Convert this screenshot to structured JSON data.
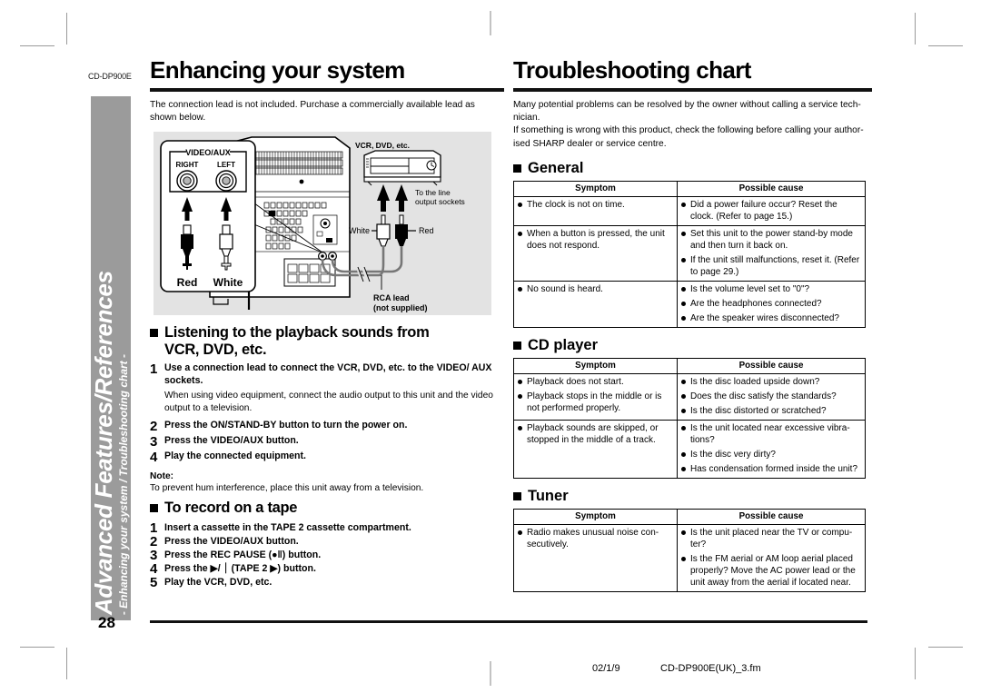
{
  "document": {
    "model_code": "CD-DP900E",
    "page_number": "28",
    "footer_date": "02/1/9",
    "footer_filename": "CD-DP900E(UK)_3.fm"
  },
  "side_tab": {
    "title": "Advanced Features/References",
    "subtitle": "- Enhancing your system / Troubleshooting chart -",
    "background_color": "#9b9b9b",
    "text_color": "#ffffff"
  },
  "left_column": {
    "heading": "Enhancing your system",
    "intro": "The connection lead is not included. Purchase a commercially available lead as shown below.",
    "diagram": {
      "labels": {
        "panel_title": "VIDEO/AUX",
        "right": "RIGHT",
        "left": "LEFT",
        "plug_red": "Red",
        "plug_white": "White",
        "device": "VCR, DVD, etc.",
        "to_line_output": "To the line\noutput sockets",
        "to_line_output_l1": "To the line",
        "to_line_output_l2": "output sockets",
        "cable_white": "White",
        "cable_red": "Red",
        "rca_lead_l1": "RCA lead",
        "rca_lead_l2": "(not supplied)"
      }
    },
    "section_listening": {
      "heading_line1": "Listening to the playback sounds from",
      "heading_line2": "VCR, DVD, etc.",
      "steps": [
        {
          "num": "1",
          "title": "Use a connection lead to connect the VCR, DVD, etc. to the VIDEO/ AUX sockets.",
          "note": "When using video equipment, connect the audio output to this unit and the video output to a television."
        },
        {
          "num": "2",
          "title": "Press the ON/STAND-BY button to turn the power on."
        },
        {
          "num": "3",
          "title": "Press the VIDEO/AUX button."
        },
        {
          "num": "4",
          "title": "Play the connected equipment."
        }
      ]
    },
    "note": {
      "label": "Note:",
      "text": "To prevent hum interference, place this unit away from a television."
    },
    "section_record": {
      "heading": "To record on a tape",
      "steps": [
        {
          "num": "1",
          "title": "Insert a cassette in the TAPE 2 cassette compartment."
        },
        {
          "num": "2",
          "title": "Press the VIDEO/AUX button."
        },
        {
          "num": "3",
          "title": "Press the REC PAUSE (●‖) button."
        },
        {
          "num": "4",
          "title": "Press the ▶/ ⏐ (TAPE 2 ▶) button."
        },
        {
          "num": "5",
          "title": "Play the VCR, DVD, etc."
        }
      ]
    }
  },
  "right_column": {
    "heading": "Troubleshooting chart",
    "intro_line1": "Many potential problems can be resolved by the owner without calling a service tech-",
    "intro_line2": "nician.",
    "intro_line3": "If something is wrong with this product, check the following before calling your author-",
    "intro_line4": "ised SHARP dealer or service centre.",
    "table_headers": {
      "symptom": "Symptom",
      "possible_cause": "Possible cause"
    },
    "sections": [
      {
        "heading": "General",
        "rows": [
          {
            "symptoms": [
              "The clock is not on time."
            ],
            "causes": [
              "Did a power failure occur? Reset the clock. (Refer to page 15.)"
            ]
          },
          {
            "symptoms": [
              "When a button is pressed, the unit does not respond."
            ],
            "causes": [
              "Set this unit to the power stand-by mode and then turn it back on.",
              "If the unit still malfunctions, reset it. (Refer to page 29.)"
            ]
          },
          {
            "symptoms": [
              "No sound is heard."
            ],
            "causes": [
              "Is the volume level set to \"0\"?",
              "Are the headphones connected?",
              "Are the speaker wires disconnected?"
            ]
          }
        ]
      },
      {
        "heading": "CD player",
        "rows": [
          {
            "symptoms": [
              "Playback does not start.",
              "Playback stops in the middle or is not performed properly."
            ],
            "causes": [
              "Is the disc loaded upside down?",
              "Does the disc satisfy the standards?",
              "Is the disc distorted or scratched?"
            ]
          },
          {
            "symptoms": [
              "Playback sounds are skipped, or stopped in the middle of a track."
            ],
            "causes": [
              "Is the unit located near excessive vibra-tions?",
              "Is the disc very dirty?",
              "Has condensation formed inside the unit?"
            ]
          }
        ]
      },
      {
        "heading": "Tuner",
        "rows": [
          {
            "symptoms": [
              "Radio makes unusual noise con-secutively."
            ],
            "causes": [
              "Is the unit placed near the TV or compu-ter?",
              "Is the FM aerial or AM loop aerial placed properly? Move the AC power lead or the unit away from the aerial if located near."
            ]
          }
        ]
      }
    ]
  }
}
